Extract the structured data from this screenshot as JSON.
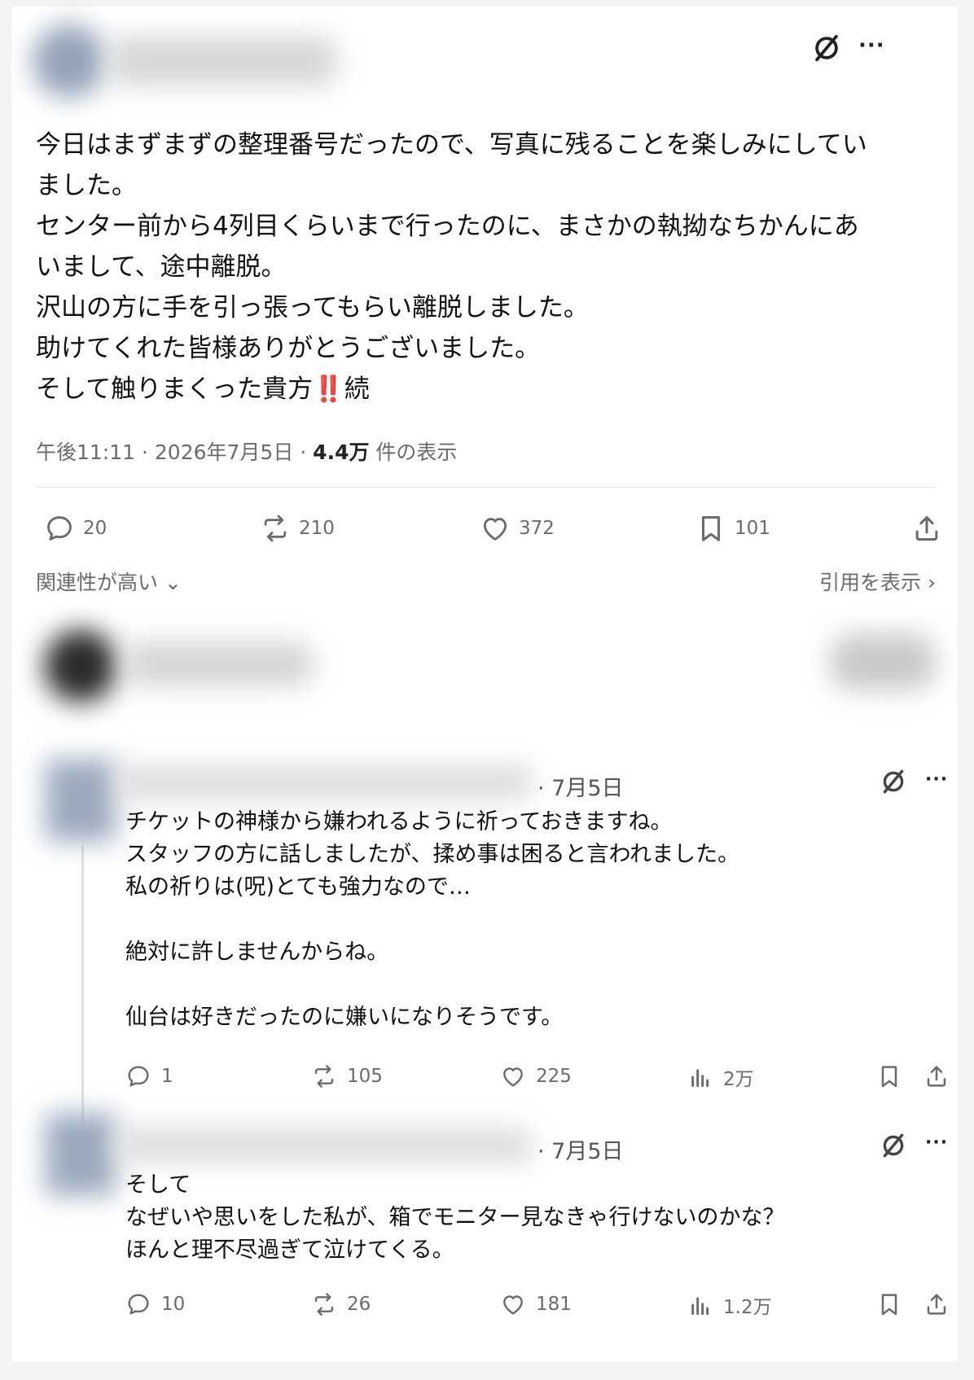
{
  "post": {
    "text_lines": [
      "今日はまずまずの整理番号だったので、写真に残ることを楽しみにしてい",
      "ました。",
      "センター前から4列目くらいまで行ったのに、まさかの執拗なちかんにあ",
      "いまして、途中離脱。",
      "沢山の方に手を引っ張ってもらい離脱しました。",
      "助けてくれた皆様ありがとうございました。",
      "そして触りまくった貴方"
    ],
    "emphasis": "‼️",
    "last_suffix": "続",
    "meta_time": "午後11:11 · 2026年7月5日 · ",
    "meta_views": "4.4万",
    "meta_views_suffix": " 件の表示",
    "actions": {
      "replies": "20",
      "reposts": "210",
      "likes": "372",
      "bookmarks": "101"
    },
    "sort_label": "関連性が高い",
    "quotes_label": "引用を表示"
  },
  "icons": {
    "reply": "reply-icon",
    "repost": "repost-icon",
    "like": "like-icon",
    "bookmark": "bookmark-icon",
    "share": "share-icon",
    "views": "views-icon",
    "grok": "slash-circle-icon",
    "more": "more-icon"
  },
  "replies": [
    {
      "date": "· 7月5日",
      "text": "チケットの神様から嫌われるように祈っておきますね。\nスタッフの方に話しましたが、揉め事は困ると言われました。\n私の祈りは(呪)とても強力なので…\n\n絶対に許しませんからね。\n\n仙台は好きだったのに嫌いになりそうです。",
      "stats": {
        "replies": "1",
        "reposts": "105",
        "likes": "225",
        "views": "2万"
      }
    },
    {
      "date": "· 7月5日",
      "text": "そして\nなぜいや思いをした私が、箱でモニター見なきゃ行けないのかな？\nほんと理不尽過ぎて泣けてくる。",
      "stats": {
        "replies": "10",
        "reposts": "26",
        "likes": "181",
        "views": "1.2万"
      }
    }
  ],
  "colors": {
    "text": "#111111",
    "muted": "#6b6b6b",
    "emphasis": "#d11a2a",
    "divider": "#e6e6e6"
  }
}
